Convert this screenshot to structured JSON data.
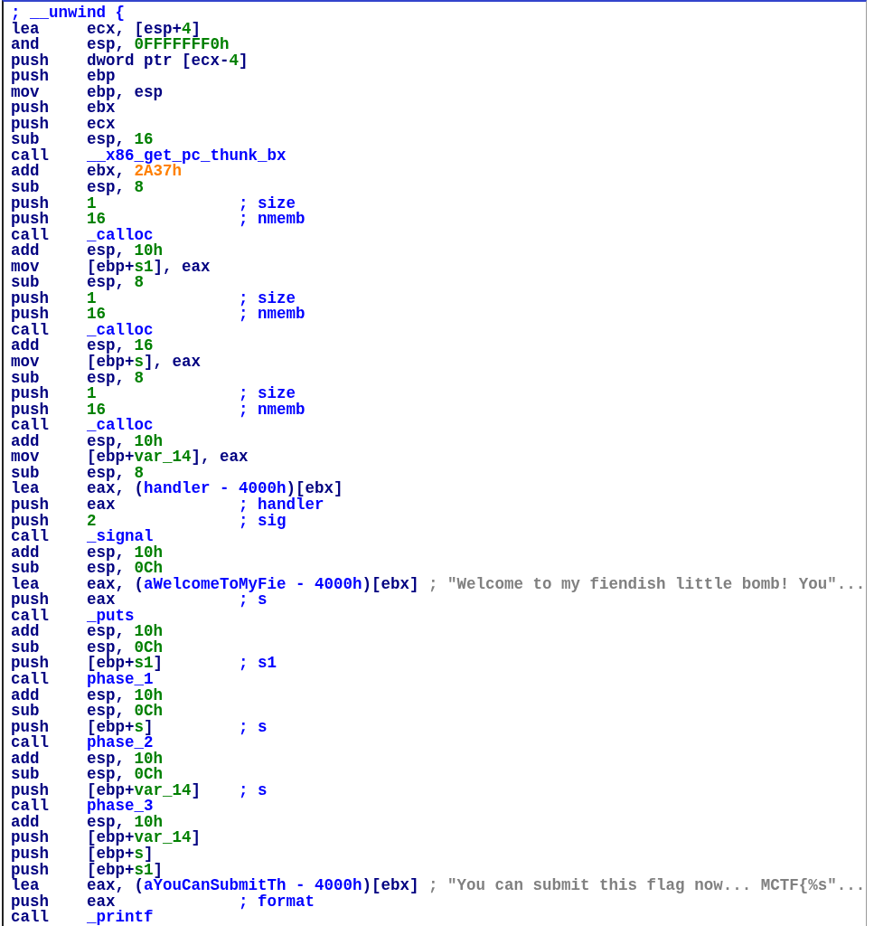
{
  "lines": [
    {
      "comment": {
        "text": "; __unwind {",
        "kind": "name"
      }
    },
    {
      "mnemonic": "lea",
      "operands": [
        {
          "text": "ecx, [esp+",
          "kind": "plain"
        },
        {
          "text": "4",
          "kind": "number"
        },
        {
          "text": "]",
          "kind": "plain"
        }
      ]
    },
    {
      "mnemonic": "and",
      "operands": [
        {
          "text": "esp, ",
          "kind": "plain"
        },
        {
          "text": "0FFFFFFF0h",
          "kind": "number"
        }
      ]
    },
    {
      "mnemonic": "push",
      "operands": [
        {
          "text": "dword ptr [ecx-",
          "kind": "plain"
        },
        {
          "text": "4",
          "kind": "number"
        },
        {
          "text": "]",
          "kind": "plain"
        }
      ]
    },
    {
      "mnemonic": "push",
      "operands": [
        {
          "text": "ebp",
          "kind": "plain"
        }
      ]
    },
    {
      "mnemonic": "mov",
      "operands": [
        {
          "text": "ebp, esp",
          "kind": "plain"
        }
      ]
    },
    {
      "mnemonic": "push",
      "operands": [
        {
          "text": "ebx",
          "kind": "plain"
        }
      ]
    },
    {
      "mnemonic": "push",
      "operands": [
        {
          "text": "ecx",
          "kind": "plain"
        }
      ]
    },
    {
      "mnemonic": "sub",
      "operands": [
        {
          "text": "esp, ",
          "kind": "plain"
        },
        {
          "text": "16",
          "kind": "number"
        }
      ]
    },
    {
      "mnemonic": "call",
      "operands": [
        {
          "text": "__x86_get_pc_thunk_bx",
          "kind": "name"
        }
      ]
    },
    {
      "mnemonic": "add",
      "operands": [
        {
          "text": "ebx, ",
          "kind": "plain"
        },
        {
          "text": "2A37h",
          "kind": "offset"
        }
      ]
    },
    {
      "mnemonic": "sub",
      "operands": [
        {
          "text": "esp, ",
          "kind": "plain"
        },
        {
          "text": "8",
          "kind": "number"
        }
      ]
    },
    {
      "mnemonic": "push",
      "operands": [
        {
          "text": "1",
          "kind": "number"
        }
      ],
      "comment": {
        "text": "; size",
        "kind": "name"
      }
    },
    {
      "mnemonic": "push",
      "operands": [
        {
          "text": "16",
          "kind": "number"
        }
      ],
      "comment": {
        "text": "; nmemb",
        "kind": "name"
      }
    },
    {
      "mnemonic": "call",
      "operands": [
        {
          "text": "_calloc",
          "kind": "name"
        }
      ]
    },
    {
      "mnemonic": "add",
      "operands": [
        {
          "text": "esp, ",
          "kind": "plain"
        },
        {
          "text": "10h",
          "kind": "number"
        }
      ]
    },
    {
      "mnemonic": "mov",
      "operands": [
        {
          "text": "[ebp+",
          "kind": "plain"
        },
        {
          "text": "s1",
          "kind": "number"
        },
        {
          "text": "], eax",
          "kind": "plain"
        }
      ]
    },
    {
      "mnemonic": "sub",
      "operands": [
        {
          "text": "esp, ",
          "kind": "plain"
        },
        {
          "text": "8",
          "kind": "number"
        }
      ]
    },
    {
      "mnemonic": "push",
      "operands": [
        {
          "text": "1",
          "kind": "number"
        }
      ],
      "comment": {
        "text": "; size",
        "kind": "name"
      }
    },
    {
      "mnemonic": "push",
      "operands": [
        {
          "text": "16",
          "kind": "number"
        }
      ],
      "comment": {
        "text": "; nmemb",
        "kind": "name"
      }
    },
    {
      "mnemonic": "call",
      "operands": [
        {
          "text": "_calloc",
          "kind": "name"
        }
      ]
    },
    {
      "mnemonic": "add",
      "operands": [
        {
          "text": "esp, ",
          "kind": "plain"
        },
        {
          "text": "16",
          "kind": "number"
        }
      ]
    },
    {
      "mnemonic": "mov",
      "operands": [
        {
          "text": "[ebp+",
          "kind": "plain"
        },
        {
          "text": "s",
          "kind": "number"
        },
        {
          "text": "], eax",
          "kind": "plain"
        }
      ]
    },
    {
      "mnemonic": "sub",
      "operands": [
        {
          "text": "esp, ",
          "kind": "plain"
        },
        {
          "text": "8",
          "kind": "number"
        }
      ]
    },
    {
      "mnemonic": "push",
      "operands": [
        {
          "text": "1",
          "kind": "number"
        }
      ],
      "comment": {
        "text": "; size",
        "kind": "name"
      }
    },
    {
      "mnemonic": "push",
      "operands": [
        {
          "text": "16",
          "kind": "number"
        }
      ],
      "comment": {
        "text": "; nmemb",
        "kind": "name"
      }
    },
    {
      "mnemonic": "call",
      "operands": [
        {
          "text": "_calloc",
          "kind": "name"
        }
      ]
    },
    {
      "mnemonic": "add",
      "operands": [
        {
          "text": "esp, ",
          "kind": "plain"
        },
        {
          "text": "10h",
          "kind": "number"
        }
      ]
    },
    {
      "mnemonic": "mov",
      "operands": [
        {
          "text": "[ebp+",
          "kind": "plain"
        },
        {
          "text": "var_14",
          "kind": "number"
        },
        {
          "text": "], eax",
          "kind": "plain"
        }
      ]
    },
    {
      "mnemonic": "sub",
      "operands": [
        {
          "text": "esp, ",
          "kind": "plain"
        },
        {
          "text": "8",
          "kind": "number"
        }
      ]
    },
    {
      "mnemonic": "lea",
      "operands": [
        {
          "text": "eax, (",
          "kind": "plain"
        },
        {
          "text": "handler - 4000h",
          "kind": "name"
        },
        {
          "text": ")[ebx]",
          "kind": "plain"
        }
      ]
    },
    {
      "mnemonic": "push",
      "operands": [
        {
          "text": "eax",
          "kind": "plain"
        }
      ],
      "comment": {
        "text": "; handler",
        "kind": "name"
      }
    },
    {
      "mnemonic": "push",
      "operands": [
        {
          "text": "2",
          "kind": "number"
        }
      ],
      "comment": {
        "text": "; sig",
        "kind": "name"
      }
    },
    {
      "mnemonic": "call",
      "operands": [
        {
          "text": "_signal",
          "kind": "name"
        }
      ]
    },
    {
      "mnemonic": "add",
      "operands": [
        {
          "text": "esp, ",
          "kind": "plain"
        },
        {
          "text": "10h",
          "kind": "number"
        }
      ]
    },
    {
      "mnemonic": "sub",
      "operands": [
        {
          "text": "esp, ",
          "kind": "plain"
        },
        {
          "text": "0Ch",
          "kind": "number"
        }
      ]
    },
    {
      "mnemonic": "lea",
      "operands": [
        {
          "text": "eax, (",
          "kind": "plain"
        },
        {
          "text": "aWelcomeToMyFie - 4000h",
          "kind": "name"
        },
        {
          "text": ")[ebx]",
          "kind": "plain"
        }
      ],
      "comment": {
        "text": "; \"Welcome to my fiendish little bomb! You\"...",
        "kind": "string"
      }
    },
    {
      "mnemonic": "push",
      "operands": [
        {
          "text": "eax",
          "kind": "plain"
        }
      ],
      "comment": {
        "text": "; s",
        "kind": "name"
      }
    },
    {
      "mnemonic": "call",
      "operands": [
        {
          "text": "_puts",
          "kind": "name"
        }
      ]
    },
    {
      "mnemonic": "add",
      "operands": [
        {
          "text": "esp, ",
          "kind": "plain"
        },
        {
          "text": "10h",
          "kind": "number"
        }
      ]
    },
    {
      "mnemonic": "sub",
      "operands": [
        {
          "text": "esp, ",
          "kind": "plain"
        },
        {
          "text": "0Ch",
          "kind": "number"
        }
      ]
    },
    {
      "mnemonic": "push",
      "operands": [
        {
          "text": "[ebp+",
          "kind": "plain"
        },
        {
          "text": "s1",
          "kind": "number"
        },
        {
          "text": "]",
          "kind": "plain"
        }
      ],
      "comment": {
        "text": "; s1",
        "kind": "name"
      }
    },
    {
      "mnemonic": "call",
      "operands": [
        {
          "text": "phase_1",
          "kind": "name"
        }
      ]
    },
    {
      "mnemonic": "add",
      "operands": [
        {
          "text": "esp, ",
          "kind": "plain"
        },
        {
          "text": "10h",
          "kind": "number"
        }
      ]
    },
    {
      "mnemonic": "sub",
      "operands": [
        {
          "text": "esp, ",
          "kind": "plain"
        },
        {
          "text": "0Ch",
          "kind": "number"
        }
      ]
    },
    {
      "mnemonic": "push",
      "operands": [
        {
          "text": "[ebp+",
          "kind": "plain"
        },
        {
          "text": "s",
          "kind": "number"
        },
        {
          "text": "]",
          "kind": "plain"
        }
      ],
      "comment": {
        "text": "; s",
        "kind": "name"
      }
    },
    {
      "mnemonic": "call",
      "operands": [
        {
          "text": "phase_2",
          "kind": "name"
        }
      ]
    },
    {
      "mnemonic": "add",
      "operands": [
        {
          "text": "esp, ",
          "kind": "plain"
        },
        {
          "text": "10h",
          "kind": "number"
        }
      ]
    },
    {
      "mnemonic": "sub",
      "operands": [
        {
          "text": "esp, ",
          "kind": "plain"
        },
        {
          "text": "0Ch",
          "kind": "number"
        }
      ]
    },
    {
      "mnemonic": "push",
      "operands": [
        {
          "text": "[ebp+",
          "kind": "plain"
        },
        {
          "text": "var_14",
          "kind": "number"
        },
        {
          "text": "]",
          "kind": "plain"
        }
      ],
      "comment": {
        "text": "; s",
        "kind": "name"
      }
    },
    {
      "mnemonic": "call",
      "operands": [
        {
          "text": "phase_3",
          "kind": "name"
        }
      ]
    },
    {
      "mnemonic": "add",
      "operands": [
        {
          "text": "esp, ",
          "kind": "plain"
        },
        {
          "text": "10h",
          "kind": "number"
        }
      ]
    },
    {
      "mnemonic": "push",
      "operands": [
        {
          "text": "[ebp+",
          "kind": "plain"
        },
        {
          "text": "var_14",
          "kind": "number"
        },
        {
          "text": "]",
          "kind": "plain"
        }
      ]
    },
    {
      "mnemonic": "push",
      "operands": [
        {
          "text": "[ebp+",
          "kind": "plain"
        },
        {
          "text": "s",
          "kind": "number"
        },
        {
          "text": "]",
          "kind": "plain"
        }
      ]
    },
    {
      "mnemonic": "push",
      "operands": [
        {
          "text": "[ebp+",
          "kind": "plain"
        },
        {
          "text": "s1",
          "kind": "number"
        },
        {
          "text": "]",
          "kind": "plain"
        }
      ]
    },
    {
      "mnemonic": "lea",
      "operands": [
        {
          "text": "eax, (",
          "kind": "plain"
        },
        {
          "text": "aYouCanSubmitTh - 4000h",
          "kind": "name"
        },
        {
          "text": ")[ebx]",
          "kind": "plain"
        }
      ],
      "comment": {
        "text": "; \"You can submit this flag now... MCTF{%s\"...",
        "kind": "string"
      }
    },
    {
      "mnemonic": "push",
      "operands": [
        {
          "text": "eax",
          "kind": "plain"
        }
      ],
      "comment": {
        "text": "; format",
        "kind": "name"
      }
    },
    {
      "mnemonic": "call",
      "operands": [
        {
          "text": "_printf",
          "kind": "name"
        }
      ]
    }
  ]
}
